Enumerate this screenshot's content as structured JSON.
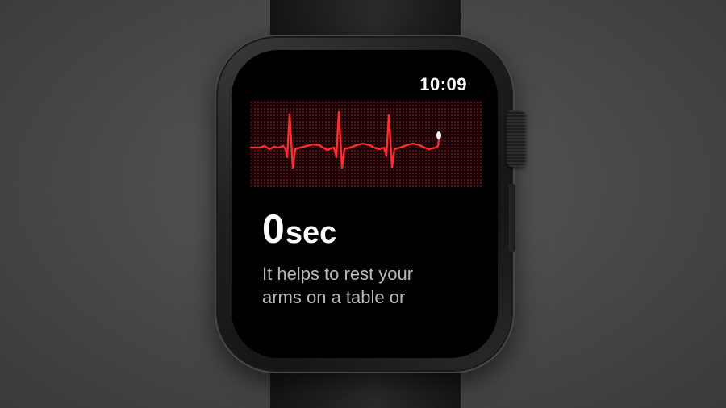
{
  "status_bar": {
    "time": "10:09"
  },
  "ecg": {
    "trace_color": "#ff2d2d",
    "grid_color": "#6b1414"
  },
  "recording": {
    "seconds_value": "0",
    "seconds_unit": "sec"
  },
  "instruction": {
    "line1": "It helps to rest your",
    "line2": "arms on a table or"
  },
  "colors": {
    "background": "#4a4a4c",
    "screen": "#000000",
    "text_primary": "#ffffff",
    "text_secondary": "#b9b9bc"
  }
}
